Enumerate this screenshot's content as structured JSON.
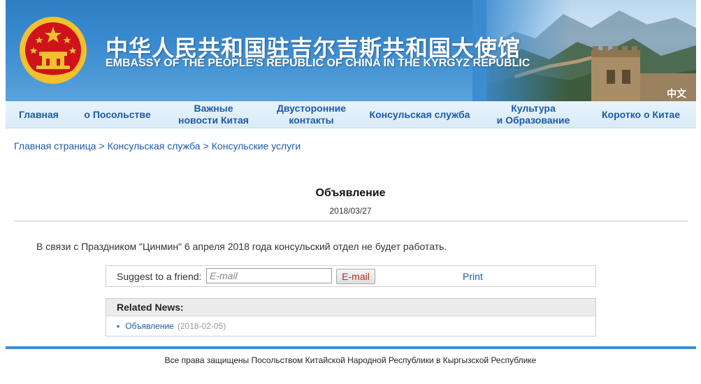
{
  "header": {
    "title_cn": "中华人民共和国驻吉尔吉斯共和国大使馆",
    "title_en": "EMBASSY OF THE PEOPLE'S REPUBLIC OF CHINA IN THE KYRGYZ REPUBLIC",
    "lang_link": "中文",
    "emblem_icon": "national-emblem-icon",
    "colors": {
      "banner": "#3b8bd0",
      "emblem_red": "#d0121b",
      "emblem_gold": "#f2c12e"
    }
  },
  "nav": {
    "items": [
      {
        "label": "Главная"
      },
      {
        "label": "о Посольстве"
      },
      {
        "label": "Важные\nновости Китая"
      },
      {
        "label": "Двусторонние\nконтакты"
      },
      {
        "label": "Консульская служба"
      },
      {
        "label": "Культура\nи Образование"
      },
      {
        "label": "Коротко о Китае"
      }
    ]
  },
  "breadcrumb": {
    "items": [
      "Главная страница",
      "Консульская служба",
      "Консульские услуги"
    ],
    "separator": ">"
  },
  "article": {
    "title": "Объявление",
    "date": "2018/03/27",
    "body": "В связи с Праздником \"Цинмин\" 6 апреля 2018 года консульский отдел не будет работать."
  },
  "share": {
    "label": "Suggest to a friend:",
    "email_placeholder": "E-mail",
    "email_button": "E-mail",
    "print_label": "Print"
  },
  "related": {
    "heading": "Related News:",
    "items": [
      {
        "title": "Объявление",
        "date": "(2018-02-05)"
      }
    ]
  },
  "footer": {
    "text": "Все права защищены Посольством Китайской Народной Республики в Кыргызской Республике",
    "bar_color": "#3b8fd0"
  }
}
